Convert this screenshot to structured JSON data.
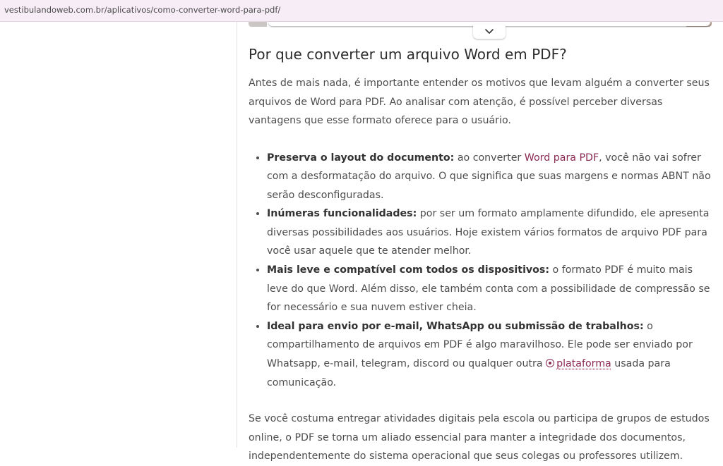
{
  "browser": {
    "url": "vestibulandoweb.com.br/aplicativos/como-converter-word-para-pdf/"
  },
  "embed": {
    "expand_icon": "chevron-down-icon"
  },
  "article": {
    "heading": "Por que converter um arquivo Word em PDF?",
    "intro": "Antes de mais nada, é importante entender os motivos que levam alguém a converter seus arquivos de Word para PDF. Ao analisar com atenção, é possível perceber diversas vantagens que esse formato oferece para o usuário.",
    "benefits": [
      {
        "title": "Preserva o layout do documento:",
        "text_before_link": " ao converter ",
        "link": "Word para PDF",
        "text_after_link": ", você não vai sofrer com a desformatação do arquivo. O que significa que suas margens e normas ABNT não serão desconfiguradas."
      },
      {
        "title": "Inúmeras funcionalidades:",
        "text": " por ser um formato amplamente difundido, ele apresenta diversas possibilidades aos usuários. Hoje existem vários formatos de arquivo PDF para você usar aquele que te atender melhor."
      },
      {
        "title": "Mais leve e compatível com todos os dispositivos:",
        "text": " o formato PDF é muito mais leve do que Word. Além disso, ele também conta com a possibilidade de compressão se for necessário e sua nuvem estiver cheia."
      },
      {
        "title": "Ideal para envio por e-mail, WhatsApp ou submissão de trabalhos:",
        "text_before_link": " o compartilhamento de arquivos em PDF é algo maravilhoso. Ele pode ser enviado por Whatsapp, e-mail, telegram, discord ou qualquer outra ",
        "link_icon": "circle-plus-icon",
        "link": "plataforma",
        "text_after_link": " usada para comunicação."
      }
    ],
    "closing": "Se você costuma entregar atividades digitais pela escola ou participa de grupos de estudos online, o PDF se torna um aliado essencial para manter a integridade dos documentos, independentemente do sistema operacional que seus colegas ou professores utilizem."
  },
  "colors": {
    "link": "#8a2a52",
    "urlbar": "#f7edf6",
    "text": "#4d4d4d"
  }
}
